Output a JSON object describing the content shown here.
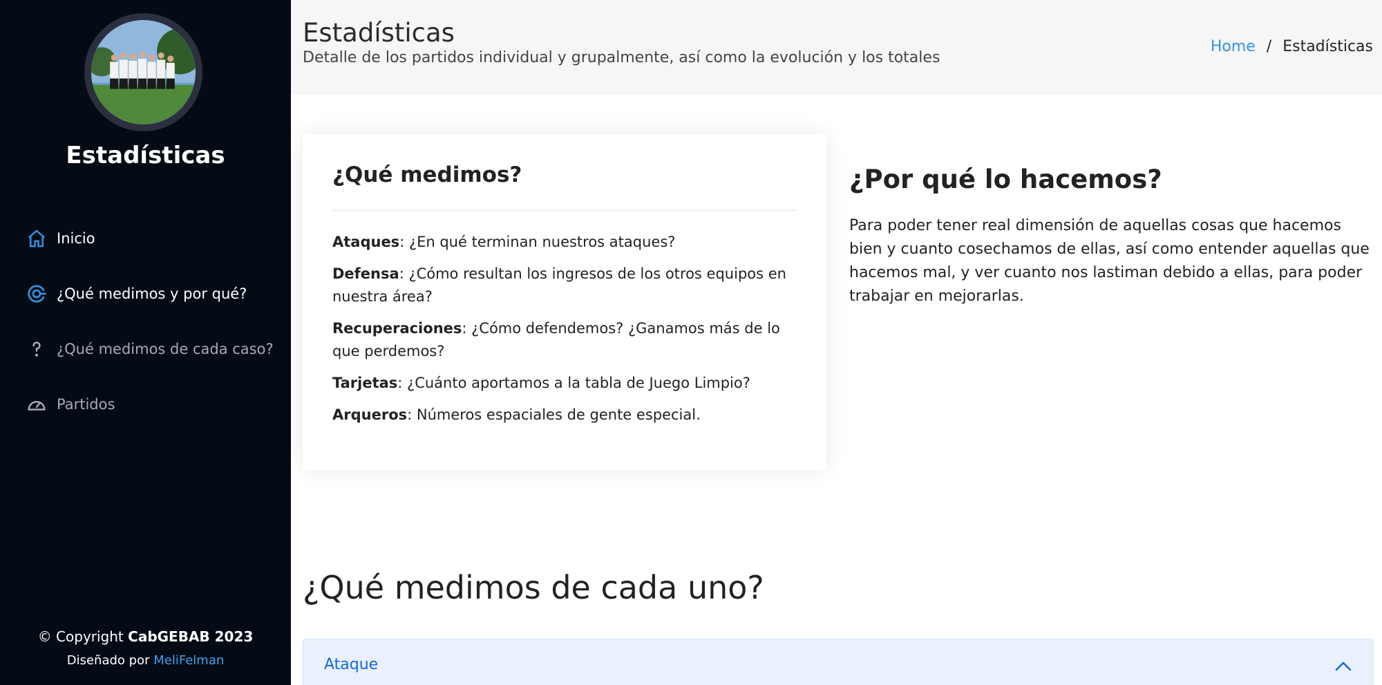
{
  "sidebar": {
    "brand": "Estadísticas",
    "items": [
      {
        "label": "Inicio",
        "icon": "home-icon",
        "active": true
      },
      {
        "label": "¿Qué medimos y por qué?",
        "icon": "target-icon",
        "active": true
      },
      {
        "label": "¿Qué medimos de cada caso?",
        "icon": "question-icon",
        "active": false
      },
      {
        "label": "Partidos",
        "icon": "speedometer-icon",
        "active": false
      }
    ],
    "copyright_prefix": "© Copyright",
    "copyright_owner": "CabGEBAB 2023",
    "designed_prefix": "Diseñado por",
    "designed_author": "MeliFelman"
  },
  "header": {
    "title": "Estadísticas",
    "subtitle": "Detalle de los partidos individual y grupalmente, así como la evolución y los totales",
    "breadcrumb_home": "Home",
    "breadcrumb_sep": "/",
    "breadcrumb_current": "Estadísticas"
  },
  "card": {
    "title": "¿Qué medimos?",
    "items": [
      {
        "term": "Ataques",
        "text": ": ¿En qué terminan nuestros ataques?"
      },
      {
        "term": "Defensa",
        "text": ": ¿Cómo resultan los ingresos de los otros equipos en nuestra área?"
      },
      {
        "term": "Recuperaciones",
        "text": ": ¿Cómo defendemos? ¿Ganamos más de lo que perdemos?"
      },
      {
        "term": "Tarjetas",
        "text": ": ¿Cuánto aportamos a la tabla de Juego Limpio?"
      },
      {
        "term": "Arqueros",
        "text": ": Números espaciales de gente especial."
      }
    ]
  },
  "why": {
    "title": "¿Por qué lo hacemos?",
    "text": "Para poder tener real dimensión de aquellas cosas que hacemos bien y cuanto cosechamos de ellas, así como entender aquellas que hacemos mal, y ver cuanto nos lastiman debido a ellas, para poder trabajar en mejorarlas."
  },
  "section": {
    "title": "¿Qué medimos de cada uno?"
  },
  "accordion": {
    "label": "Ataque",
    "icon": "chevron-up-icon"
  },
  "colors": {
    "sidebar_bg": "#040b14",
    "accent": "#3193e2",
    "accordion_text": "#1565d8"
  }
}
